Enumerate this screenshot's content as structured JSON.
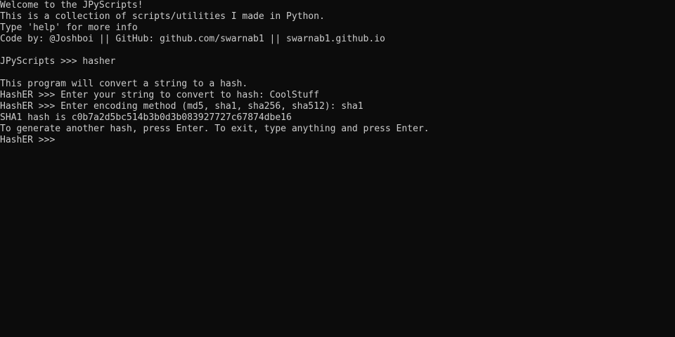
{
  "terminal": {
    "theme": {
      "background": "#0c0c0c",
      "foreground": "#cccccc"
    },
    "lines": [
      "Welcome to the JPyScripts!",
      "This is a collection of scripts/utilities I made in Python.",
      "Type 'help' for more info",
      "Code by: @Joshboi || GitHub: github.com/swarnab1 || swarnab1.github.io",
      "",
      "JPyScripts >>> hasher",
      "",
      "This program will convert a string to a hash.",
      "HashER >>> Enter your string to convert to hash: CoolStuff",
      "HashER >>> Enter encoding method (md5, sha1, sha256, sha512): sha1",
      "SHA1 hash is c0b7a2d5bc514b3b0d3b083927727c67874dbe16",
      "To generate another hash, press Enter. To exit, type anything and press Enter."
    ],
    "active_prompt": "HashER >>> ",
    "input_value": ""
  }
}
